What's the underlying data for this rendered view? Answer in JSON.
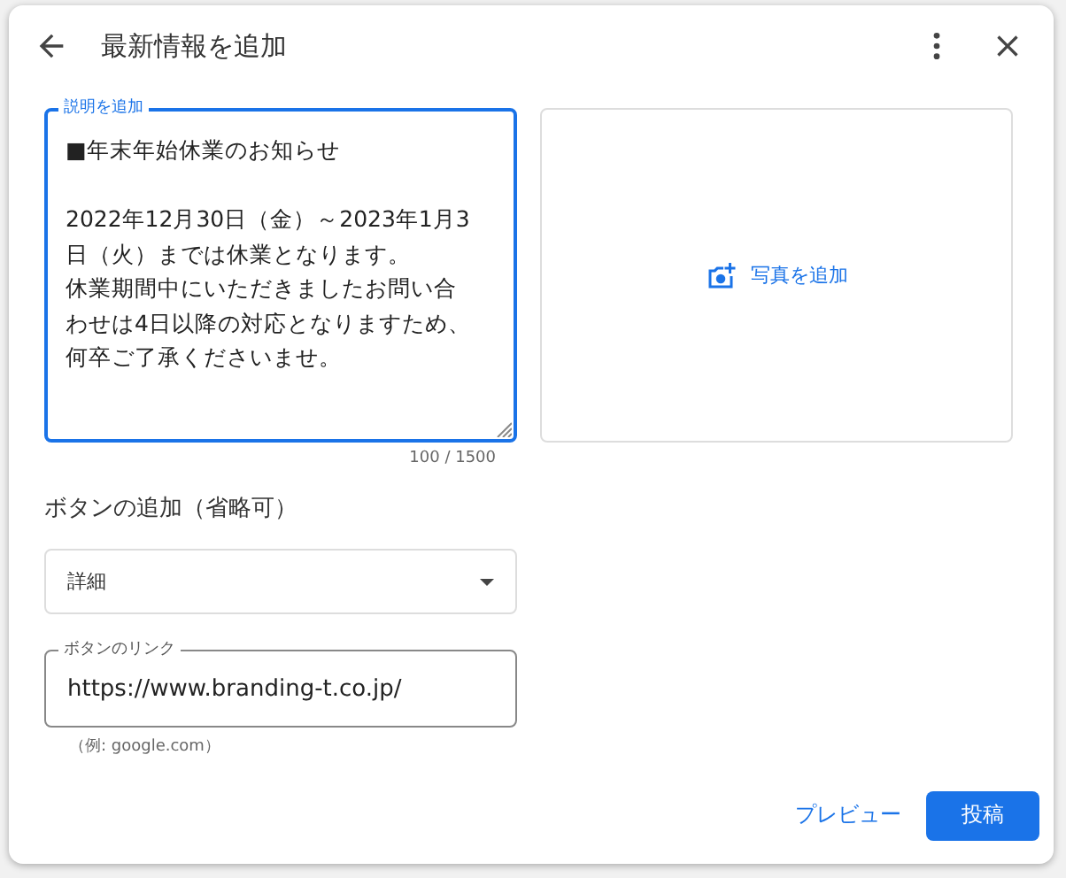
{
  "dialog": {
    "title": "最新情報を追加"
  },
  "description": {
    "label": "説明を追加",
    "title_line": "■年末年始休業のお知らせ",
    "body_lines": [
      "2022年12月30日（金）～2023年1月3",
      "日（火）までは休業となります。",
      "休業期間中にいただきましたお問い合",
      "わせは4日以降の対応となりますため、",
      "何卒ご了承くださいませ。"
    ],
    "counter": "100 / 1500",
    "focused": true
  },
  "photo": {
    "label": "写真を追加"
  },
  "button_section": {
    "heading": "ボタンの追加（省略可）",
    "select_value": "詳細",
    "link_label": "ボタンのリンク",
    "link_value": "https://www.branding-t.co.jp/",
    "link_hint": "（例: google.com）"
  },
  "actions": [
    {
      "label": "プレビュー",
      "kind": "text"
    },
    {
      "label": "投稿",
      "kind": "primary"
    }
  ]
}
